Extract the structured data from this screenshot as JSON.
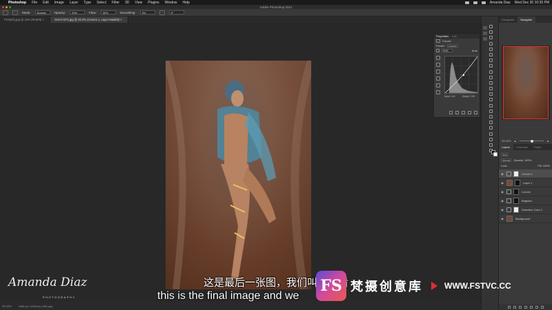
{
  "menubar": {
    "app": "Photoshop",
    "items": [
      "File",
      "Edit",
      "Image",
      "Layer",
      "Type",
      "Select",
      "Filter",
      "3D",
      "View",
      "Plugins",
      "Window",
      "Help"
    ],
    "user": "Amanda Diaz",
    "datetime": "Wed Dec 30  10:35 PM"
  },
  "window": {
    "title": "Adobe Photoshop 2021"
  },
  "options": {
    "mode_label": "Mode:",
    "mode_value": "Normal",
    "opacity_label": "Opacity:",
    "opacity_value": "20%",
    "flow_label": "Flow:",
    "flow_value": "30%",
    "smoothing_label": "Smoothing:",
    "smoothing_value": "0%",
    "angle_value": "0°"
  },
  "tabs": [
    {
      "label": "PrettyFly.jpg @ 16% (RGB/8) ×"
    },
    {
      "label": "SHAA7274.jpg @ 33.3% (Curves 1, Layer Mask/8) ×"
    }
  ],
  "properties": {
    "tab_active": "Properties",
    "tab_inactive": "Info",
    "adjustment": "Curves",
    "preset_label": "Preset:",
    "preset_value": "Custom",
    "channel_value": "RGB",
    "auto_label": "Auto",
    "input_label": "Input: 144",
    "output_label": "Output: 139"
  },
  "navigator": {
    "tab_histogram": "Histogram",
    "tab_navigator": "Navigator",
    "zoom": "33.33%"
  },
  "layers": {
    "tab_layers": "Layers",
    "tab_channels": "Channels",
    "tab_paths": "Paths",
    "kind": "Kind",
    "blend": "Normal",
    "opacity": "Opacity: 100%",
    "lock": "Lock:",
    "fill": "Fill: 100%",
    "items": [
      {
        "name": "Curves 1",
        "type": "adjustment",
        "active": true
      },
      {
        "name": "Layer 1",
        "type": "pixel",
        "active": false
      },
      {
        "name": "Curves",
        "type": "adjustment",
        "active": false
      },
      {
        "name": "Brighten",
        "type": "adjustment",
        "active": false
      },
      {
        "name": "Selective Color 1",
        "type": "adjustment",
        "active": false
      },
      {
        "name": "Background",
        "type": "pixel",
        "active": false
      }
    ]
  },
  "status": {
    "zoom": "33.33%",
    "doc_size": "3456 px x 5184 px (240 ppi)"
  },
  "subtitles": {
    "chinese": "这是最后一张图，我们叫它看看",
    "english": "this is the final image and we"
  },
  "signature": {
    "name": "Amanda Diaz",
    "subtitle": "PHOTOGRAPHY"
  },
  "watermark": {
    "logo_text": "FS",
    "site_cn": "梵摄创意库",
    "url": "WWW.FSTVC.CC"
  }
}
